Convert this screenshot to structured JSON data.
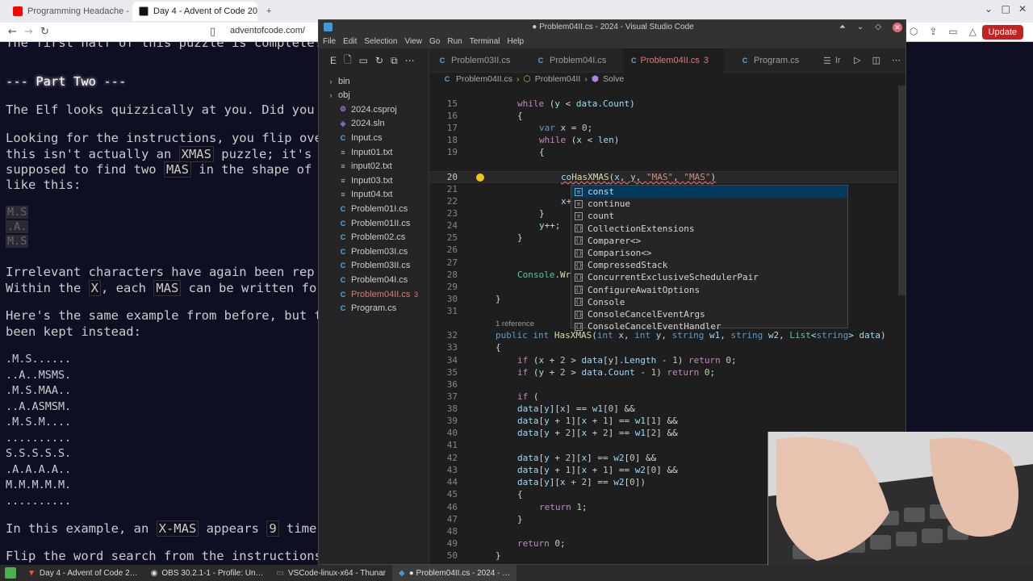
{
  "browser": {
    "tabs": [
      {
        "title": "Programming Headache - You…",
        "active": false,
        "color": "#ff0000"
      },
      {
        "title": "Day 4 - Advent of Code 2024",
        "active": true,
        "color": "#111111"
      }
    ],
    "new_tab": "+",
    "url": "adventofcode.com/",
    "update_label": "Update"
  },
  "aoc": {
    "lines": {
      "l0": "The first half of this puzzle is complete!",
      "l1": "--- Part Two ---",
      "l2": "The Elf looks quizzically at you. Did you",
      "l3": "Looking for the instructions, you flip ove",
      "l4a": "this isn't actually an ",
      "l4b": "XMAS",
      "l4c": " puzzle; it's a",
      "l5a": "supposed to find two ",
      "l5b": "MAS",
      "l5c": " in the shape of a",
      "l6": "like this:",
      "l10": "Irrelevant characters have again been rep",
      "l11a": "Within the ",
      "l11b": "X",
      "l11c": ", each ",
      "l11d": "MAS",
      "l11e": " can be written forw",
      "l12": "Here's the same example from before, but t",
      "l13": "been kept instead:",
      "l14a": "In this example, an ",
      "l14b": "X-MAS",
      "l14c": " appears ",
      "l14d": "9",
      "l14e": " times",
      "l15": "Flip the word search from the instructions"
    },
    "small_grid": [
      "M.S",
      ".A.",
      "M.S"
    ],
    "big_grid": [
      ".M.S......",
      "..A..MSMS.",
      ".M.S.MAA..",
      "..A.ASMSM.",
      ".M.S.M....",
      "..........",
      "S.S.S.S.S.",
      ".A.A.A.A..",
      "M.M.M.M.M.",
      ".........."
    ]
  },
  "taskbar": {
    "items": [
      {
        "label": "Day 4 - Advent of Code 2…",
        "active": false
      },
      {
        "label": "OBS 30.2.1-1 - Profile: Un…",
        "active": false
      },
      {
        "label": "VSCode-linux-x64 - Thunar",
        "active": false
      },
      {
        "label": "● Problem04II.cs - 2024 - …",
        "active": true
      }
    ]
  },
  "vscode": {
    "title": "● Problem04II.cs - 2024 - Visual Studio Code",
    "menu": [
      "File",
      "Edit",
      "Selection",
      "View",
      "Go",
      "Run",
      "Terminal",
      "Help"
    ],
    "explorer_letter": "E",
    "files": [
      {
        "name": "bin",
        "type": "folder"
      },
      {
        "name": "obj",
        "type": "folder"
      },
      {
        "name": "2024.csproj",
        "type": "proj"
      },
      {
        "name": "2024.sln",
        "type": "sln"
      },
      {
        "name": "Input.cs",
        "type": "cs"
      },
      {
        "name": "Input01.txt",
        "type": "txt"
      },
      {
        "name": "input02.txt",
        "type": "txt"
      },
      {
        "name": "Input03.txt",
        "type": "txt"
      },
      {
        "name": "Input04.txt",
        "type": "txt"
      },
      {
        "name": "Problem01I.cs",
        "type": "cs"
      },
      {
        "name": "Problem01II.cs",
        "type": "cs"
      },
      {
        "name": "Problem02.cs",
        "type": "cs"
      },
      {
        "name": "Problem03I.cs",
        "type": "cs"
      },
      {
        "name": "Problem03II.cs",
        "type": "cs"
      },
      {
        "name": "Problem04I.cs",
        "type": "cs"
      },
      {
        "name": "Problem04II.cs",
        "type": "cs",
        "modified": true,
        "badge": "3"
      },
      {
        "name": "Program.cs",
        "type": "cs"
      }
    ],
    "tabs": [
      {
        "name": "Problem03II.cs",
        "active": false
      },
      {
        "name": "Problem04I.cs",
        "active": false
      },
      {
        "name": "Problem04II.cs",
        "active": true,
        "badge": "3"
      },
      {
        "name": "Program.cs",
        "active": false
      },
      {
        "name": "Ir",
        "active": false
      }
    ],
    "breadcrumb": [
      "Problem04II.cs",
      "Problem04II",
      "Solve"
    ],
    "codelens": "1 reference",
    "suggestions": [
      "const",
      "continue",
      "count",
      "CollectionExtensions",
      "Comparer<>",
      "Comparison<>",
      "CompressedStack",
      "ConcurrentExclusiveSchedulerPair",
      "ConfigureAwaitOptions",
      "Console",
      "ConsoleCancelEventArgs",
      "ConsoleCancelEventHandler"
    ]
  }
}
